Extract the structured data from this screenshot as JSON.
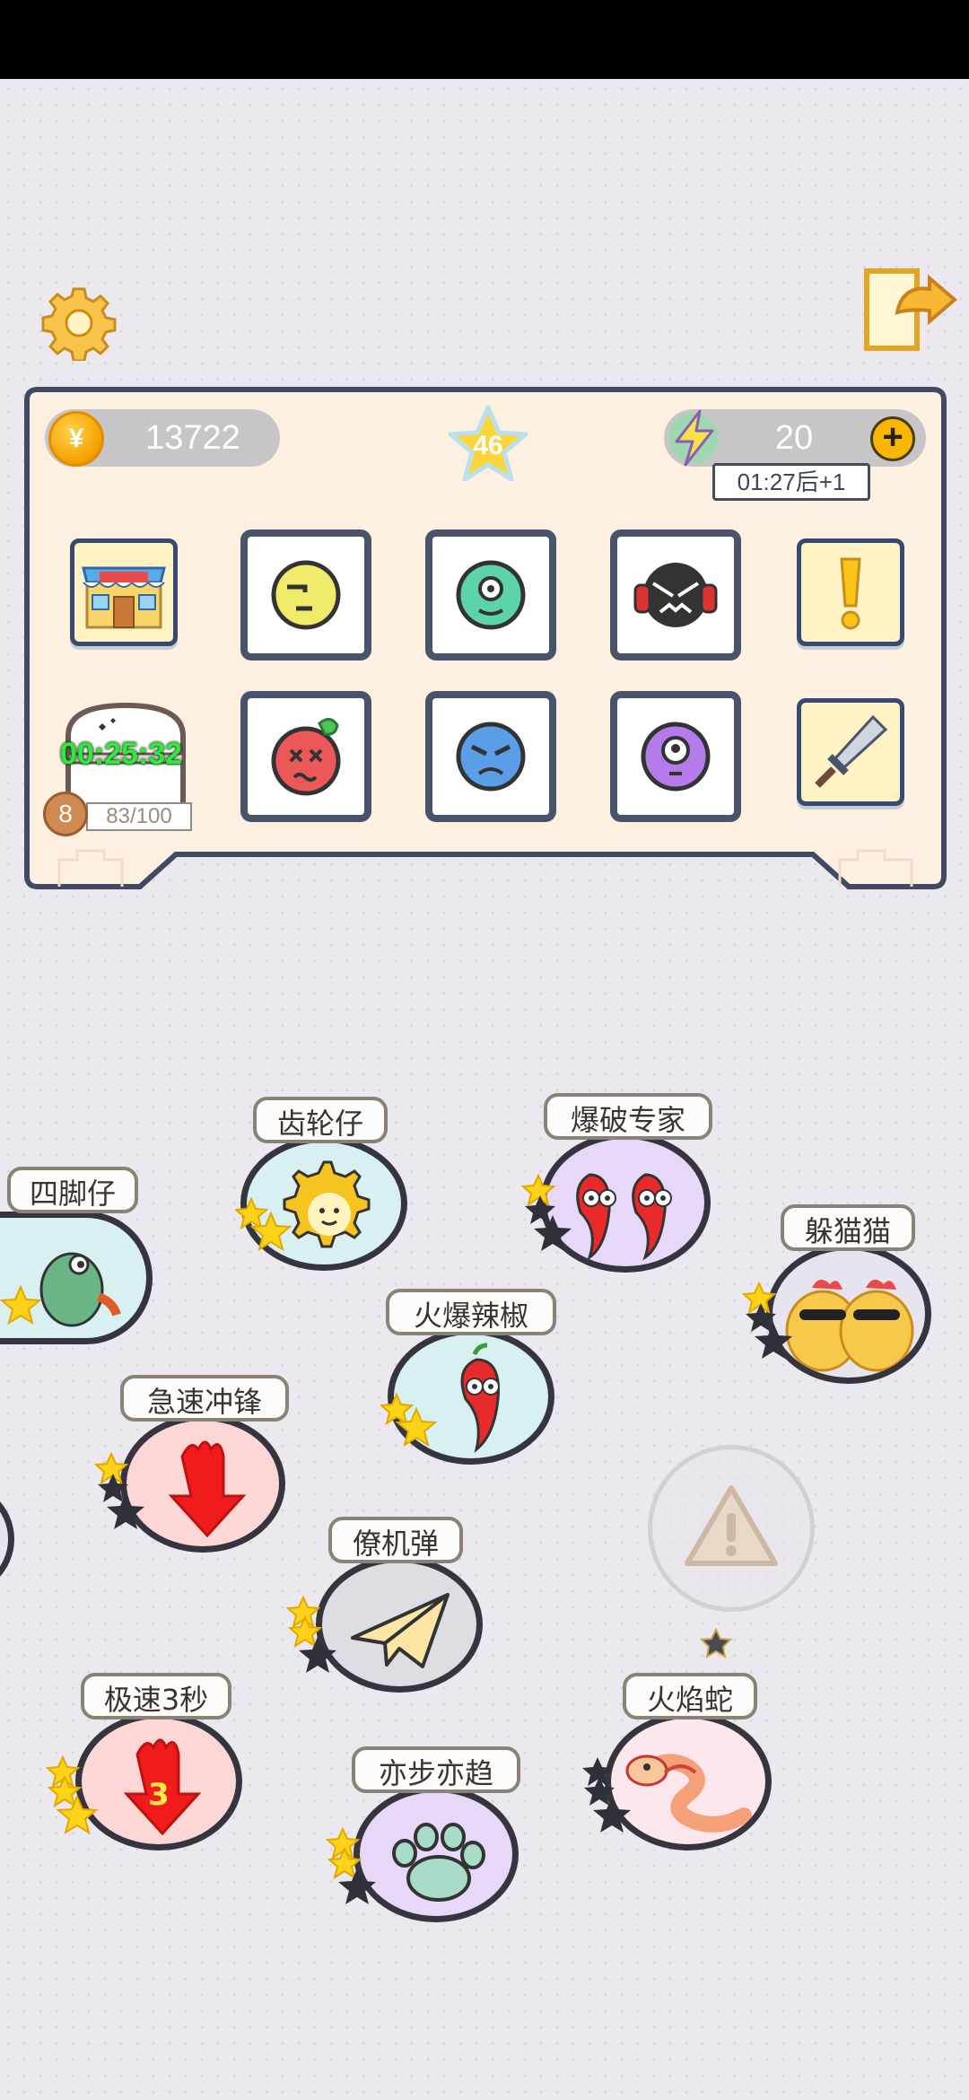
{
  "header": {
    "gear_icon": "gear-icon",
    "exit_icon": "exit-icon"
  },
  "resources": {
    "coin_symbol": "¥",
    "coins": "13722",
    "stars": "46",
    "energy": "20",
    "energy_plus": "+",
    "energy_timer": "01:27后+1"
  },
  "chest": {
    "timer": "00:25:32",
    "level": "8",
    "progress": "83/100"
  },
  "slots_row1": [
    {
      "icon": "shop-icon"
    },
    {
      "icon": "yellow-face-icon"
    },
    {
      "icon": "green-face-icon"
    },
    {
      "icon": "headphone-face-icon"
    },
    {
      "icon": "exclamation-icon"
    }
  ],
  "slots_row2": [
    {
      "icon": "treasure-chest-icon"
    },
    {
      "icon": "red-face-icon"
    },
    {
      "icon": "blue-face-icon"
    },
    {
      "icon": "purple-face-icon"
    },
    {
      "icon": "sword-icon"
    }
  ],
  "characters": [
    {
      "label": "四脚仔",
      "stars_gold": 1,
      "stars_total": 1
    },
    {
      "label": "齿轮仔",
      "stars_gold": 2,
      "stars_total": 2
    },
    {
      "label": "爆破专家",
      "stars_gold": 1,
      "stars_total": 3
    },
    {
      "label": "躲猫猫",
      "stars_gold": 1,
      "stars_total": 3
    },
    {
      "label": "火爆辣椒",
      "stars_gold": 2,
      "stars_total": 2
    },
    {
      "label": "急速冲锋",
      "stars_gold": 1,
      "stars_total": 3
    },
    {
      "label": "僚机弹",
      "stars_gold": 2,
      "stars_total": 3
    },
    {
      "label": "极速3秒",
      "stars_gold": 3,
      "stars_total": 3
    },
    {
      "label": "亦步亦趋",
      "stars_gold": 2,
      "stars_total": 3
    },
    {
      "label": "火焰蛇",
      "stars_gold": 0,
      "stars_total": 3
    }
  ],
  "locked_node": {
    "icon": "warning-icon",
    "stars_gold": 0,
    "stars_total": 1
  },
  "colors": {
    "panel_bg": "#fdf0e0",
    "panel_border": "#3f4a63",
    "star_gold": "#fcd318",
    "star_dark": "#2f3038",
    "label_border": "#8a8276"
  }
}
